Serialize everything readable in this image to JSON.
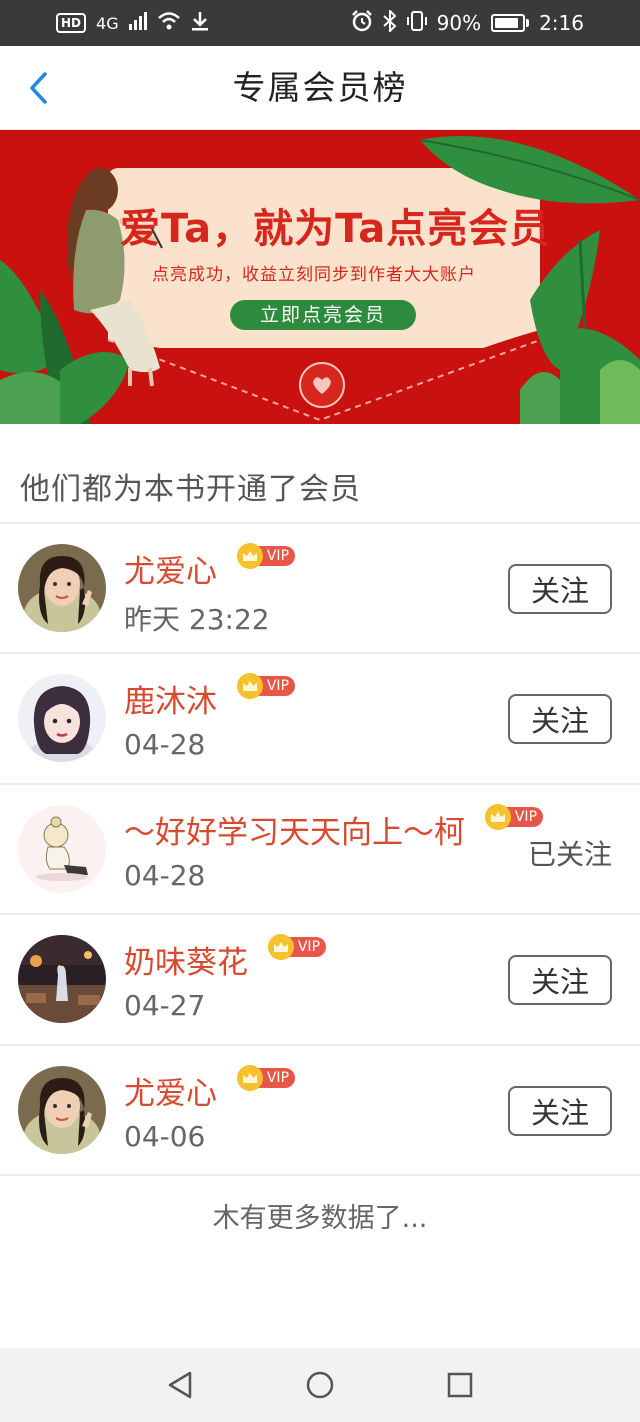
{
  "status_bar": {
    "network_badge": "HD",
    "network_type": "4G",
    "battery_percent": "90%",
    "battery_level": 0.9,
    "time": "2:16",
    "icons": [
      "signal-icon",
      "wifi-icon",
      "download-icon",
      "alarm-icon",
      "bluetooth-icon",
      "vibrate-icon",
      "battery-icon"
    ]
  },
  "header": {
    "title": "专属会员榜",
    "back_icon": "chevron-left-icon"
  },
  "banner": {
    "title": "爱Ta，就为Ta点亮会员",
    "subtitle": "点亮成功，收益立刻同步到作者大大账户",
    "button_label": "立即点亮会员",
    "colors": {
      "background": "#c9110f",
      "card": "#fbe2cc",
      "button": "#2e8a3d",
      "leaf": "#2f8f3f"
    }
  },
  "section": {
    "title": "他们都为本书开通了会员"
  },
  "members": [
    {
      "name": "尤爱心",
      "vip": "VIP",
      "time": "昨天 23:22",
      "follow_label": "关注",
      "followed": false,
      "avatar": "portrait-woman-icon"
    },
    {
      "name": "鹿沐沐",
      "vip": "VIP",
      "time": "04-28",
      "follow_label": "关注",
      "followed": false,
      "avatar": "portrait-girl-icon"
    },
    {
      "name": "～好好学习天天向上～柯",
      "vip": "VIP",
      "time": "04-28",
      "follow_label": "已关注",
      "followed": true,
      "avatar": "cartoon-girl-icon"
    },
    {
      "name": "奶味葵花",
      "vip": "VIP",
      "time": "04-27",
      "follow_label": "关注",
      "followed": false,
      "avatar": "night-street-icon"
    },
    {
      "name": "尤爱心",
      "vip": "VIP",
      "time": "04-06",
      "follow_label": "关注",
      "followed": false,
      "avatar": "portrait-woman-icon"
    }
  ],
  "footer": {
    "no_more_text": "木有更多数据了..."
  },
  "system_nav": {
    "icons": [
      "back-triangle-icon",
      "home-circle-icon",
      "recents-square-icon"
    ]
  },
  "colors": {
    "accent_name": "#d84a2f",
    "back_arrow": "#1e88e5",
    "vip_badge": "#e8564a",
    "vip_crown": "#f6c12c"
  }
}
